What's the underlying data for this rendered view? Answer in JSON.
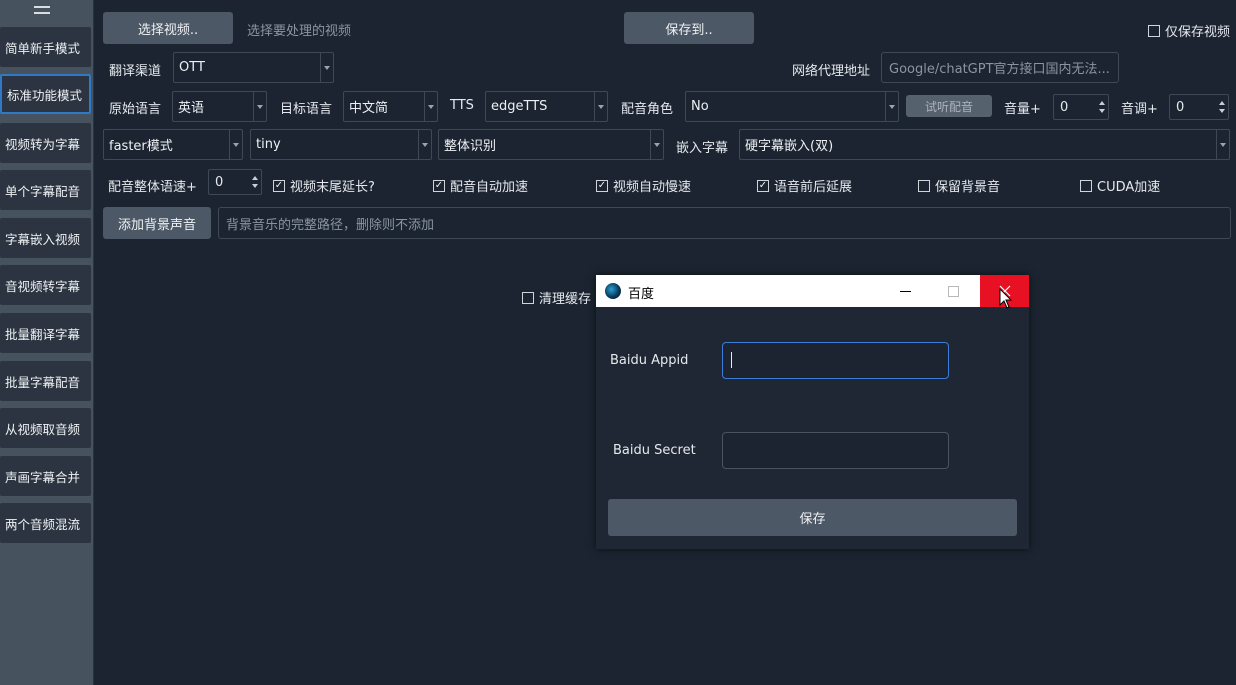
{
  "sidebar": {
    "items": [
      {
        "label": "简单新手模式"
      },
      {
        "label": "标准功能模式"
      },
      {
        "label": "视频转为字幕"
      },
      {
        "label": "单个字幕配音"
      },
      {
        "label": "字幕嵌入视频"
      },
      {
        "label": "音视频转字幕"
      },
      {
        "label": "批量翻译字幕"
      },
      {
        "label": "批量字幕配音"
      },
      {
        "label": "从视频取音频"
      },
      {
        "label": "声画字幕合并"
      },
      {
        "label": "两个音频混流"
      }
    ]
  },
  "toolbar": {
    "select_video_label": "选择视频..",
    "select_video_hint": "选择要处理的视频",
    "save_to_label": "保存到..",
    "only_save_video_label": "仅保存视频"
  },
  "row_translate": {
    "channel_label": "翻译渠道",
    "channel_value": "OTT",
    "proxy_label": "网络代理地址",
    "proxy_placeholder": "Google/chatGPT官方接口国内无法..."
  },
  "row_lang": {
    "source_label": "原始语言",
    "source_value": "英语",
    "target_label": "目标语言",
    "target_value": "中文简",
    "tts_label": "TTS",
    "tts_value": "edgeTTS",
    "voice_label": "配音角色",
    "voice_value": "No",
    "preview_label": "试听配音",
    "volume_label": "音量+",
    "volume_value": "0",
    "pitch_label": "音调+",
    "pitch_value": "0"
  },
  "row_model": {
    "mode_value": "faster模式",
    "model_value": "tiny",
    "recog_value": "整体识别",
    "embed_label": "嵌入字幕",
    "embed_value": "硬字幕嵌入(双)"
  },
  "row_options": {
    "speed_label": "配音整体语速+",
    "speed_value": "0",
    "extend_label": "视频末尾延长?",
    "auto_speed_label": "配音自动加速",
    "auto_slow_label": "视频自动慢速",
    "voice_extend_label": "语音前后延展",
    "keep_bg_label": "保留背景音",
    "cuda_label": "CUDA加速"
  },
  "row_bg": {
    "add_bg_label": "添加背景声音",
    "bg_placeholder": "背景音乐的完整路径，删除则不添加"
  },
  "clear_cache_label": "清理缓存",
  "dialog": {
    "title": "百度",
    "appid_label": "Baidu Appid",
    "appid_value": "",
    "secret_label": "Baidu Secret",
    "secret_value": "",
    "save_label": "保存",
    "close_color": "#e81123"
  }
}
